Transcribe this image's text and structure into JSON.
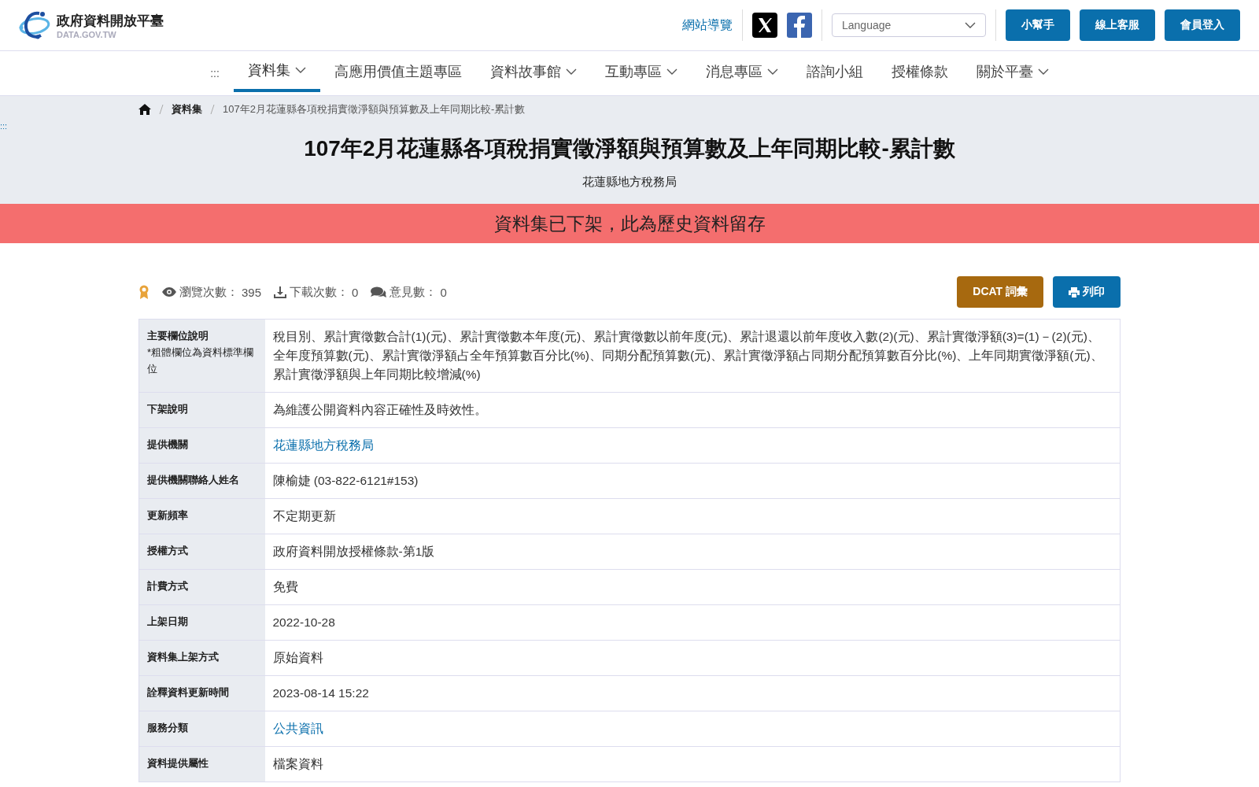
{
  "header": {
    "logo": {
      "title": "政府資料開放平臺",
      "subtitle": "DATA.GOV.TW"
    },
    "sitemap_link": "網站導覽",
    "language_select": {
      "placeholder": "Language"
    },
    "buttons": [
      "小幫手",
      "線上客服",
      "會員登入"
    ]
  },
  "nav": {
    "menu_glyph": ":::",
    "items": [
      {
        "label": "資料集",
        "has_menu": true,
        "selected": true
      },
      {
        "label": "高應用價值主題專區",
        "has_menu": false,
        "selected": false
      },
      {
        "label": "資料故事館",
        "has_menu": true,
        "selected": false
      },
      {
        "label": "互動專區",
        "has_menu": true,
        "selected": false
      },
      {
        "label": "消息專區",
        "has_menu": true,
        "selected": false
      },
      {
        "label": "諮詢小組",
        "has_menu": false,
        "selected": false
      },
      {
        "label": "授權條款",
        "has_menu": false,
        "selected": false
      },
      {
        "label": "關於平臺",
        "has_menu": true,
        "selected": false
      }
    ]
  },
  "skip_link": ":::",
  "breadcrumb": [
    {
      "label": "資料集",
      "kind": "link"
    },
    {
      "label": "107年2月花蓮縣各項稅捐實徵淨額與預算數及上年同期比較-累計數",
      "kind": "current"
    }
  ],
  "title": "107年2月花蓮縣各項稅捐實徵淨額與預算數及上年同期比較-累計數",
  "agency": "花蓮縣地方稅務局",
  "banner": "資料集已下架，此為歷史資料留存",
  "stats": [
    {
      "kind": "views",
      "label": "瀏覽次數：",
      "value": "395"
    },
    {
      "kind": "downloads",
      "label": "下載次數：",
      "value": "0"
    },
    {
      "kind": "comments",
      "label": "意見數：",
      "value": "0"
    }
  ],
  "actions": [
    {
      "kind": "dcat",
      "label": "DCAT 詞彙"
    },
    {
      "kind": "print",
      "label": "列印"
    }
  ],
  "table": {
    "rows": [
      {
        "label": "主要欄位說明",
        "note": "*粗體欄位為資料標準欄位",
        "kind": "text",
        "value": "稅目別、累計實徵數合計(1)(元)、累計實徵數本年度(元)、累計實徵數以前年度(元)、累計退還以前年度收入數(2)(元)、累計實徵淨額(3)=(1)－(2)(元)、全年度預算數(元)、累計實徵淨額占全年預算數百分比(%)、同期分配預算數(元)、累計實徵淨額占同期分配預算數百分比(%)、上年同期實徵淨額(元)、累計實徵淨額與上年同期比較增減(%)"
      },
      {
        "label": "下架說明",
        "kind": "text",
        "value": "為維護公開資料內容正確性及時效性。"
      },
      {
        "label": "提供機關",
        "kind": "link",
        "value": "花蓮縣地方稅務局"
      },
      {
        "label": "提供機關聯絡人姓名",
        "kind": "text",
        "value": "陳榆婕 (03-822-6121#153)"
      },
      {
        "label": "更新頻率",
        "kind": "text",
        "value": "不定期更新"
      },
      {
        "label": "授權方式",
        "kind": "text",
        "value": "政府資料開放授權條款-第1版"
      },
      {
        "label": "計費方式",
        "kind": "text",
        "value": "免費"
      },
      {
        "label": "上架日期",
        "kind": "text",
        "value": "2022-10-28"
      },
      {
        "label": "資料集上架方式",
        "kind": "text",
        "value": "原始資料"
      },
      {
        "label": "詮釋資料更新時間",
        "kind": "text",
        "value": "2023-08-14 15:22"
      },
      {
        "label": "服務分類",
        "kind": "link",
        "value": "公共資訊"
      },
      {
        "label": "資料提供屬性",
        "kind": "text",
        "value": "檔案資料"
      }
    ]
  }
}
